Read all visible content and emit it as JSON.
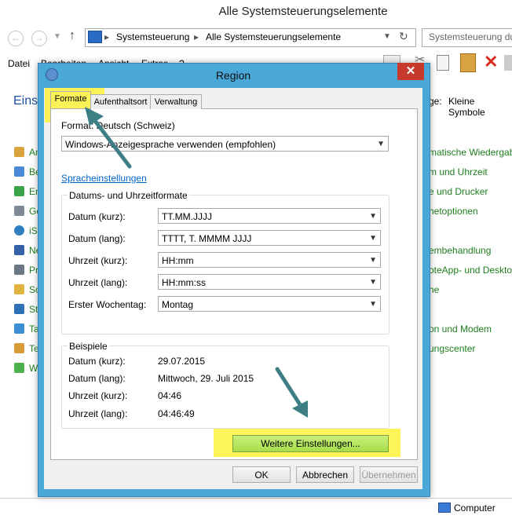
{
  "window": {
    "title": "Alle Systemsteuerungselemente",
    "breadcrumb": [
      "Systemsteuerung",
      "Alle Systemsteuerungselemente"
    ],
    "search_placeholder": "Systemsteuerung du",
    "menu": [
      "Datei",
      "Bearbeiten",
      "Ansicht",
      "Extras",
      "?"
    ],
    "left_heading": "Einst",
    "view_label": "ge:",
    "view_value": "Kleine Symbole",
    "left_items": [
      "An",
      "Be",
      "En",
      "Ge",
      "iS",
      "Ne",
      "Pr",
      "So",
      "St",
      "Ta",
      "Te",
      "W"
    ],
    "right_items": [
      "matische Wiedergab",
      "m und Uhrzeit",
      "e und Drucker",
      "netoptionen",
      "embehandlung",
      "oteApp- und Desktop",
      "he",
      "on und Modem",
      "ungscenter"
    ],
    "status_text": "Computer"
  },
  "dialog": {
    "title": "Region",
    "close_glyph": "✕",
    "tabs": [
      "Formate",
      "Aufenthaltsort",
      "Verwaltung"
    ],
    "format_label": "Format: Deutsch (Schweiz)",
    "format_value": "Windows-Anzeigesprache verwenden (empfohlen)",
    "language_link": "Spracheinstellungen",
    "date_group": {
      "title": "Datums- und Uhrzeitformate",
      "rows": [
        {
          "label": "Datum (kurz):",
          "value": "TT.MM.JJJJ"
        },
        {
          "label": "Datum (lang):",
          "value": "TTTT, T. MMMM JJJJ"
        },
        {
          "label": "Uhrzeit (kurz):",
          "value": "HH:mm"
        },
        {
          "label": "Uhrzeit (lang):",
          "value": "HH:mm:ss"
        },
        {
          "label": "Erster Wochentag:",
          "value": "Montag"
        }
      ]
    },
    "examples": {
      "title": "Beispiele",
      "rows": [
        {
          "label": "Datum (kurz):",
          "value": "29.07.2015"
        },
        {
          "label": "Datum (lang):",
          "value": "Mittwoch, 29. Juli 2015"
        },
        {
          "label": "Uhrzeit (kurz):",
          "value": "04:46"
        },
        {
          "label": "Uhrzeit (lang):",
          "value": "04:46:49"
        }
      ]
    },
    "more_button": "Weitere Einstellungen...",
    "ok": "OK",
    "cancel": "Abbrechen",
    "apply": "Übernehmen"
  },
  "colors": {
    "highlight": "#fdf23c",
    "arrow": "#3e7f86",
    "dialog_frame": "#4aa8d8",
    "close": "#c7392b",
    "link": "#0066cc"
  }
}
